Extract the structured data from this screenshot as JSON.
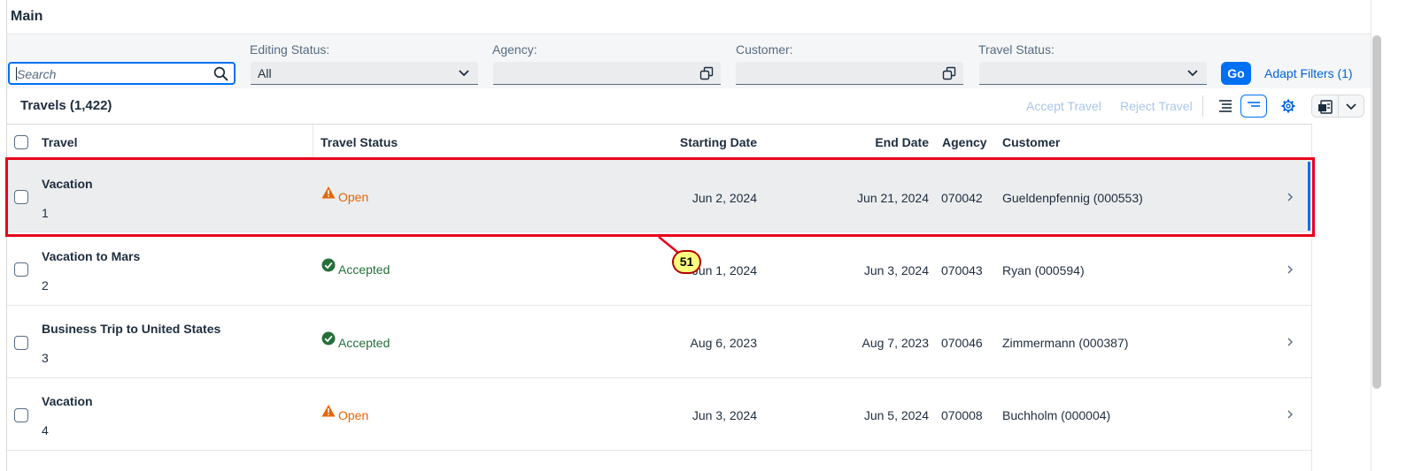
{
  "page": {
    "title": "Main"
  },
  "search": {
    "placeholder": "Search"
  },
  "filters": {
    "editing_status": {
      "label": "Editing Status:",
      "value": "All"
    },
    "agency": {
      "label": "Agency:",
      "value": ""
    },
    "customer": {
      "label": "Customer:",
      "value": ""
    },
    "travel_status": {
      "label": "Travel Status:",
      "value": ""
    },
    "go_label": "Go",
    "adapt_label": "Adapt Filters (1)"
  },
  "toolbar": {
    "title": "Travels (1,422)",
    "accept_label": "Accept Travel",
    "reject_label": "Reject Travel"
  },
  "table": {
    "columns": [
      "Travel",
      "Travel Status",
      "Starting Date",
      "End Date",
      "Agency",
      "Customer"
    ],
    "rows": [
      {
        "title": "Vacation",
        "id": "1",
        "status": "Open",
        "start": "Jun 2, 2024",
        "end": "Jun 21, 2024",
        "agency": "070042",
        "customer": "Gueldenpfennig (000553)"
      },
      {
        "title": "Vacation to Mars",
        "id": "2",
        "status": "Accepted",
        "start": "Jun 1, 2024",
        "end": "Jun 3, 2024",
        "agency": "070043",
        "customer": "Ryan (000594)"
      },
      {
        "title": "Business Trip to United States",
        "id": "3",
        "status": "Accepted",
        "start": "Aug 6, 2023",
        "end": "Aug 7, 2023",
        "agency": "070046",
        "customer": "Zimmermann (000387)"
      },
      {
        "title": "Vacation",
        "id": "4",
        "status": "Open",
        "start": "Jun 3, 2024",
        "end": "Jun 5, 2024",
        "agency": "070008",
        "customer": "Buchholm (000004)"
      }
    ]
  },
  "annotation": {
    "badge": "51"
  },
  "colors": {
    "accent": "#0070f2",
    "open": "#e76500",
    "accepted": "#256f3a",
    "highlight": "#e8001c"
  },
  "icons": {
    "search": "search-icon",
    "value_help": "value-help-icon",
    "dropdown": "chevron-down-icon",
    "open": "warning-icon",
    "accepted": "check-circle-icon",
    "row_nav": "chevron-right-icon"
  }
}
